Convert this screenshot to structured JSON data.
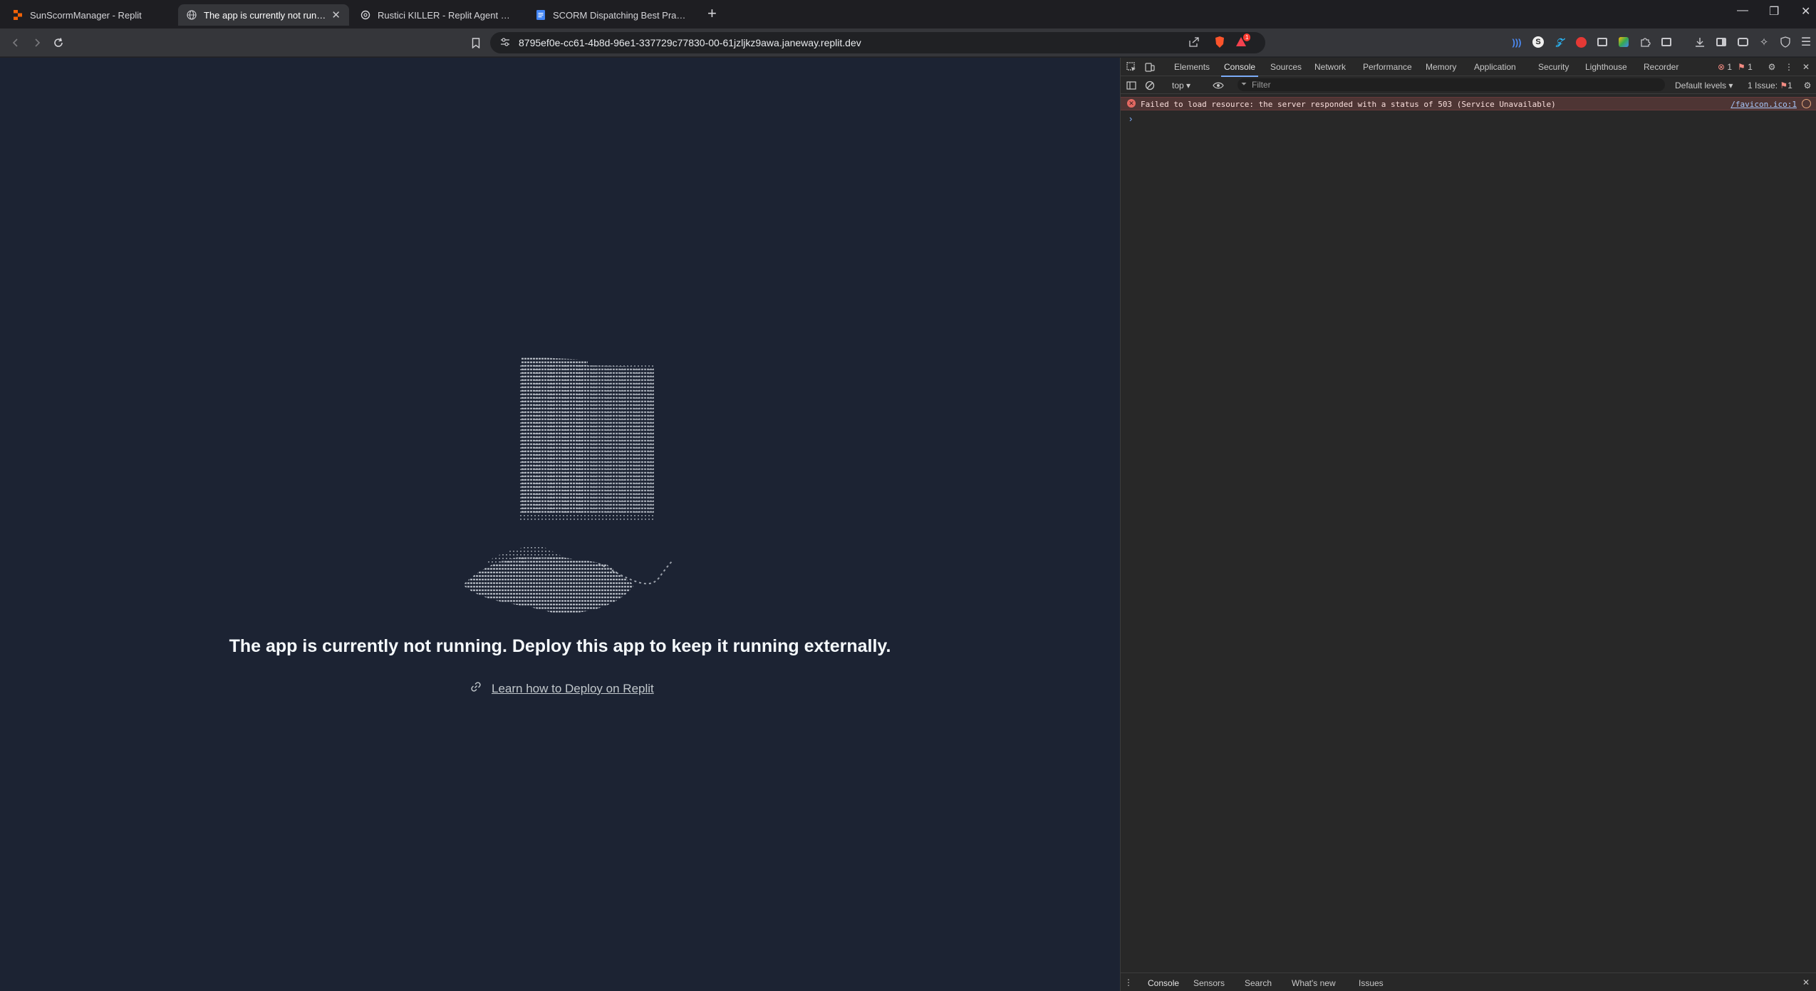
{
  "browser": {
    "tabs": [
      {
        "title": "SunScormManager - Replit",
        "icon": "replit-icon"
      },
      {
        "title": "The app is currently not running",
        "icon": "globe-icon"
      },
      {
        "title": "Rustici KILLER - Replit Agent Workflo",
        "icon": "openai-icon"
      },
      {
        "title": "SCORM Dispatching Best Practices - (",
        "icon": "docs-icon"
      }
    ],
    "new_tab_label": "+",
    "url": "8795ef0e-cc61-4b8d-96e1-337729c77830-00-61jzljkz9awa.janeway.replit.dev",
    "notification_count": "1"
  },
  "page": {
    "headline": "The app is currently not running. Deploy this app to keep it running externally.",
    "link_text": "Learn how to Deploy on Replit"
  },
  "devtools": {
    "tabs": [
      "Elements",
      "Console",
      "Sources",
      "Network",
      "Performance",
      "Memory",
      "Application",
      "Security",
      "Lighthouse",
      "Recorder"
    ],
    "active_tab": "Console",
    "error_badge": "1",
    "issue_badge": "1",
    "context": "top ▾",
    "filter_placeholder": "Filter",
    "levels": "Default levels ▾",
    "issues_label": "1 Issue:",
    "issues_count": "1",
    "console_error": {
      "message": "Failed to load resource: the server responded with a status of 503 (Service Unavailable)",
      "source": "/favicon.ico:1"
    },
    "prompt": "›",
    "drawer_tabs": [
      "Console",
      "Sensors",
      "Search",
      "What's new",
      "Issues"
    ]
  },
  "colors": {
    "page_background": "#1c2333",
    "devtools_background": "#282828",
    "error_background": "#4e3534",
    "accent": "#7cacf8"
  }
}
